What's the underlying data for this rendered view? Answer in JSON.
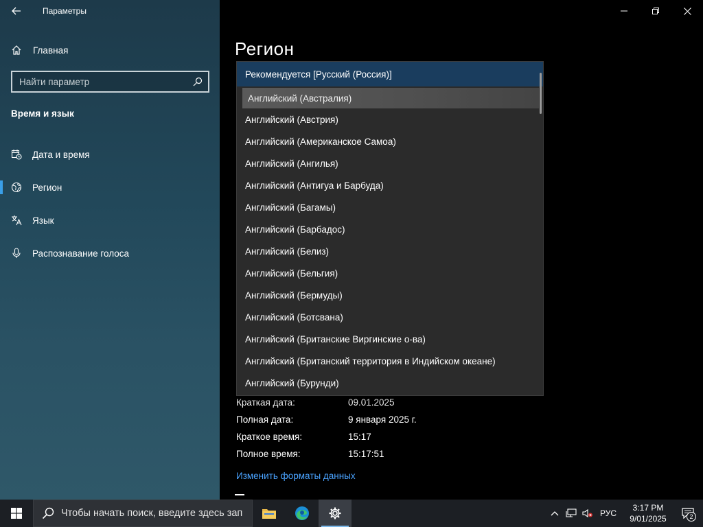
{
  "window": {
    "app_title": "Параметры",
    "minimize_label": "Свернуть",
    "maximize_label": "Развернуть",
    "close_label": "Закрыть"
  },
  "sidebar": {
    "home_label": "Главная",
    "search_placeholder": "Найти параметр",
    "section_title": "Время и язык",
    "items": [
      {
        "label": "Дата и время",
        "icon": "calendar-clock-icon"
      },
      {
        "label": "Регион",
        "icon": "globe-icon",
        "active": true
      },
      {
        "label": "Язык",
        "icon": "language-icon"
      },
      {
        "label": "Распознавание голоса",
        "icon": "microphone-icon"
      }
    ]
  },
  "main": {
    "page_title": "Регион",
    "formats": [
      {
        "label": "Краткая дата:",
        "value": "09.01.2025"
      },
      {
        "label": "Полная дата:",
        "value": "9 января 2025 г."
      },
      {
        "label": "Краткое время:",
        "value": "15:17"
      },
      {
        "label": "Полное время:",
        "value": "15:17:51"
      }
    ],
    "change_formats_link": "Изменить форматы данных"
  },
  "dropdown": {
    "selected": "Рекомендуется [Русский (Россия)]",
    "hovered": "Английский (Австралия)",
    "options": [
      "Английский (Австрия)",
      "Английский (Американское Самоа)",
      "Английский (Ангилья)",
      "Английский (Антигуа и Барбуда)",
      "Английский (Багамы)",
      "Английский (Барбадос)",
      "Английский (Белиз)",
      "Английский (Бельгия)",
      "Английский (Бермуды)",
      "Английский (Ботсвана)",
      "Английский (Британские Виргинские о-ва)",
      "Английский (Британский территория в Индийском океане)",
      "Английский (Бурунди)"
    ]
  },
  "taskbar": {
    "search_placeholder": "Чтобы начать поиск, введите здесь зап",
    "language": "РУС",
    "time": "3:17 PM",
    "date": "9/01/2025",
    "notification_count": "2",
    "accent_color": "#7db9ea"
  }
}
